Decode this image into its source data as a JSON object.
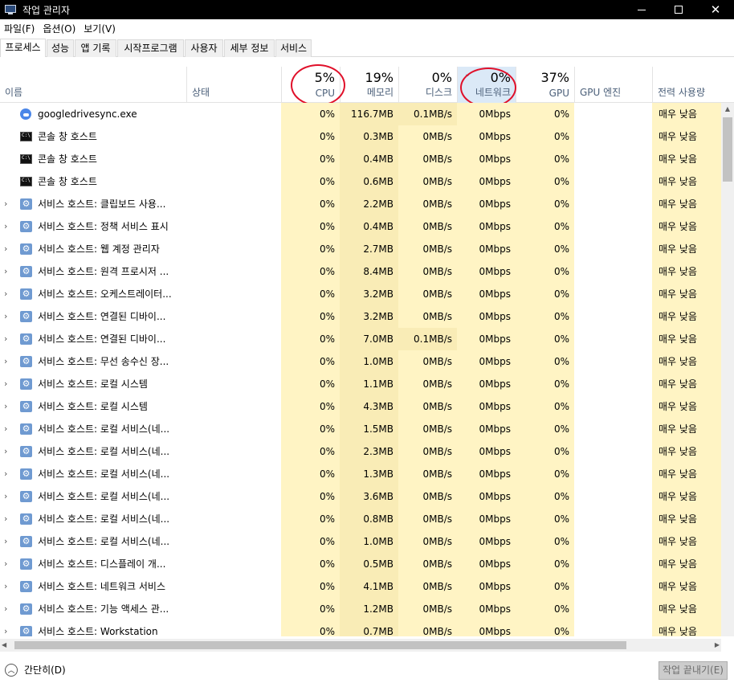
{
  "window": {
    "title": "작업 관리자"
  },
  "menu": [
    "파일(F)",
    "옵션(O)",
    "보기(V)"
  ],
  "tabs": [
    "프로세스",
    "성능",
    "앱 기록",
    "시작프로그램",
    "사용자",
    "세부 정보",
    "서비스"
  ],
  "columns": {
    "name": "이름",
    "status": "상태",
    "cpu": {
      "pct": "5%",
      "label": "CPU"
    },
    "memory": {
      "pct": "19%",
      "label": "메모리"
    },
    "disk": {
      "pct": "0%",
      "label": "디스크"
    },
    "network": {
      "pct": "0%",
      "label": "네트워크"
    },
    "gpu": {
      "pct": "37%",
      "label": "GPU"
    },
    "gpu_engine": "GPU 엔진",
    "power": "전력 사용량"
  },
  "processes": [
    {
      "icon": "google-drive-icon",
      "expandable": false,
      "name": "googledrivesync.exe",
      "cpu": "0%",
      "memory": "116.7MB",
      "disk": "0.1MB/s",
      "network": "0Mbps",
      "gpu": "0%",
      "power": "매우 낮음"
    },
    {
      "icon": "console-icon",
      "expandable": false,
      "name": "콘솔 창 호스트",
      "cpu": "0%",
      "memory": "0.3MB",
      "disk": "0MB/s",
      "network": "0Mbps",
      "gpu": "0%",
      "power": "매우 낮음"
    },
    {
      "icon": "console-icon",
      "expandable": false,
      "name": "콘솔 창 호스트",
      "cpu": "0%",
      "memory": "0.4MB",
      "disk": "0MB/s",
      "network": "0Mbps",
      "gpu": "0%",
      "power": "매우 낮음"
    },
    {
      "icon": "console-icon",
      "expandable": false,
      "name": "콘솔 창 호스트",
      "cpu": "0%",
      "memory": "0.6MB",
      "disk": "0MB/s",
      "network": "0Mbps",
      "gpu": "0%",
      "power": "매우 낮음"
    },
    {
      "icon": "gear-icon",
      "expandable": true,
      "name": "서비스 호스트: 클립보드 사용...",
      "cpu": "0%",
      "memory": "2.2MB",
      "disk": "0MB/s",
      "network": "0Mbps",
      "gpu": "0%",
      "power": "매우 낮음"
    },
    {
      "icon": "gear-icon",
      "expandable": true,
      "name": "서비스 호스트: 정책 서비스 표시",
      "cpu": "0%",
      "memory": "0.4MB",
      "disk": "0MB/s",
      "network": "0Mbps",
      "gpu": "0%",
      "power": "매우 낮음"
    },
    {
      "icon": "gear-icon",
      "expandable": true,
      "name": "서비스 호스트: 웹 계정 관리자",
      "cpu": "0%",
      "memory": "2.7MB",
      "disk": "0MB/s",
      "network": "0Mbps",
      "gpu": "0%",
      "power": "매우 낮음"
    },
    {
      "icon": "gear-icon",
      "expandable": true,
      "name": "서비스 호스트: 원격 프로시저 ...",
      "cpu": "0%",
      "memory": "8.4MB",
      "disk": "0MB/s",
      "network": "0Mbps",
      "gpu": "0%",
      "power": "매우 낮음"
    },
    {
      "icon": "gear-icon",
      "expandable": true,
      "name": "서비스 호스트: 오케스트레이터...",
      "cpu": "0%",
      "memory": "3.2MB",
      "disk": "0MB/s",
      "network": "0Mbps",
      "gpu": "0%",
      "power": "매우 낮음"
    },
    {
      "icon": "gear-icon",
      "expandable": true,
      "name": "서비스 호스트: 연결된 디바이...",
      "cpu": "0%",
      "memory": "3.2MB",
      "disk": "0MB/s",
      "network": "0Mbps",
      "gpu": "0%",
      "power": "매우 낮음"
    },
    {
      "icon": "gear-icon",
      "expandable": true,
      "name": "서비스 호스트: 연결된 디바이...",
      "cpu": "0%",
      "memory": "7.0MB",
      "disk": "0.1MB/s",
      "network": "0Mbps",
      "gpu": "0%",
      "power": "매우 낮음"
    },
    {
      "icon": "gear-icon",
      "expandable": true,
      "name": "서비스 호스트: 무선 송수신 장...",
      "cpu": "0%",
      "memory": "1.0MB",
      "disk": "0MB/s",
      "network": "0Mbps",
      "gpu": "0%",
      "power": "매우 낮음"
    },
    {
      "icon": "gear-icon",
      "expandable": true,
      "name": "서비스 호스트: 로컬 시스템",
      "cpu": "0%",
      "memory": "1.1MB",
      "disk": "0MB/s",
      "network": "0Mbps",
      "gpu": "0%",
      "power": "매우 낮음"
    },
    {
      "icon": "gear-icon",
      "expandable": true,
      "name": "서비스 호스트: 로컬 시스템",
      "cpu": "0%",
      "memory": "4.3MB",
      "disk": "0MB/s",
      "network": "0Mbps",
      "gpu": "0%",
      "power": "매우 낮음"
    },
    {
      "icon": "gear-icon",
      "expandable": true,
      "name": "서비스 호스트: 로컬 서비스(네...",
      "cpu": "0%",
      "memory": "1.5MB",
      "disk": "0MB/s",
      "network": "0Mbps",
      "gpu": "0%",
      "power": "매우 낮음"
    },
    {
      "icon": "gear-icon",
      "expandable": true,
      "name": "서비스 호스트: 로컬 서비스(네...",
      "cpu": "0%",
      "memory": "2.3MB",
      "disk": "0MB/s",
      "network": "0Mbps",
      "gpu": "0%",
      "power": "매우 낮음"
    },
    {
      "icon": "gear-icon",
      "expandable": true,
      "name": "서비스 호스트: 로컬 서비스(네...",
      "cpu": "0%",
      "memory": "1.3MB",
      "disk": "0MB/s",
      "network": "0Mbps",
      "gpu": "0%",
      "power": "매우 낮음"
    },
    {
      "icon": "gear-icon",
      "expandable": true,
      "name": "서비스 호스트: 로컬 서비스(네...",
      "cpu": "0%",
      "memory": "3.6MB",
      "disk": "0MB/s",
      "network": "0Mbps",
      "gpu": "0%",
      "power": "매우 낮음"
    },
    {
      "icon": "gear-icon",
      "expandable": true,
      "name": "서비스 호스트: 로컬 서비스(네...",
      "cpu": "0%",
      "memory": "0.8MB",
      "disk": "0MB/s",
      "network": "0Mbps",
      "gpu": "0%",
      "power": "매우 낮음"
    },
    {
      "icon": "gear-icon",
      "expandable": true,
      "name": "서비스 호스트: 로컬 서비스(네...",
      "cpu": "0%",
      "memory": "1.0MB",
      "disk": "0MB/s",
      "network": "0Mbps",
      "gpu": "0%",
      "power": "매우 낮음"
    },
    {
      "icon": "gear-icon",
      "expandable": true,
      "name": "서비스 호스트: 디스플레이 개...",
      "cpu": "0%",
      "memory": "0.5MB",
      "disk": "0MB/s",
      "network": "0Mbps",
      "gpu": "0%",
      "power": "매우 낮음"
    },
    {
      "icon": "gear-icon",
      "expandable": true,
      "name": "서비스 호스트: 네트워크 서비스",
      "cpu": "0%",
      "memory": "4.1MB",
      "disk": "0MB/s",
      "network": "0Mbps",
      "gpu": "0%",
      "power": "매우 낮음"
    },
    {
      "icon": "gear-icon",
      "expandable": true,
      "name": "서비스 호스트: 기능 액세스 관...",
      "cpu": "0%",
      "memory": "1.2MB",
      "disk": "0MB/s",
      "network": "0Mbps",
      "gpu": "0%",
      "power": "매우 낮음"
    },
    {
      "icon": "gear-icon",
      "expandable": true,
      "name": "서비스 호스트: Workstation",
      "cpu": "0%",
      "memory": "0.7MB",
      "disk": "0MB/s",
      "network": "0Mbps",
      "gpu": "0%",
      "power": "매우 낮음"
    }
  ],
  "footer": {
    "fewer_details": "간단히(D)",
    "end_task": "작업 끝내기(E)"
  },
  "colors": {
    "heat": "#fff4c4",
    "heat_hot": "#f9ecb6",
    "sorted_header": "#dbe9f7",
    "annotation": "#e0102a"
  }
}
